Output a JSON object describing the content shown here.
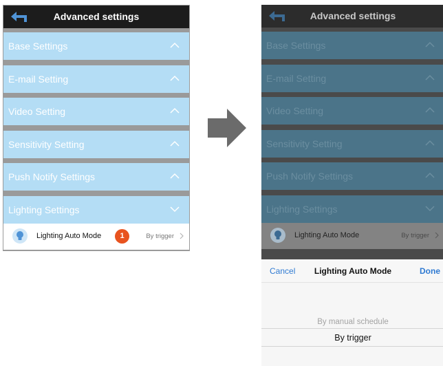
{
  "header": {
    "title": "Advanced settings"
  },
  "sections": [
    {
      "label": "Base Settings",
      "state": "collapsed"
    },
    {
      "label": "E-mail Setting",
      "state": "collapsed"
    },
    {
      "label": "Video Setting",
      "state": "collapsed"
    },
    {
      "label": "Sensitivity Setting",
      "state": "collapsed"
    },
    {
      "label": "Push Notify Settings",
      "state": "collapsed"
    },
    {
      "label": "Lighting Settings",
      "state": "expanded"
    }
  ],
  "lighting_row": {
    "label": "Lighting Auto Mode",
    "value": "By trigger",
    "icon": "lightbulb-icon"
  },
  "step_badge": "1",
  "sheet": {
    "cancel": "Cancel",
    "title": "Lighting Auto Mode",
    "done": "Done",
    "options": [
      "By manual schedule",
      "By trigger"
    ],
    "selected": "By trigger"
  },
  "colors": {
    "header_bg": "#1c1c1c",
    "section_bg": "#b4ddf5",
    "badge": "#e8531f",
    "link_blue": "#2f7ad2",
    "arrow": "#6b6b6b"
  }
}
